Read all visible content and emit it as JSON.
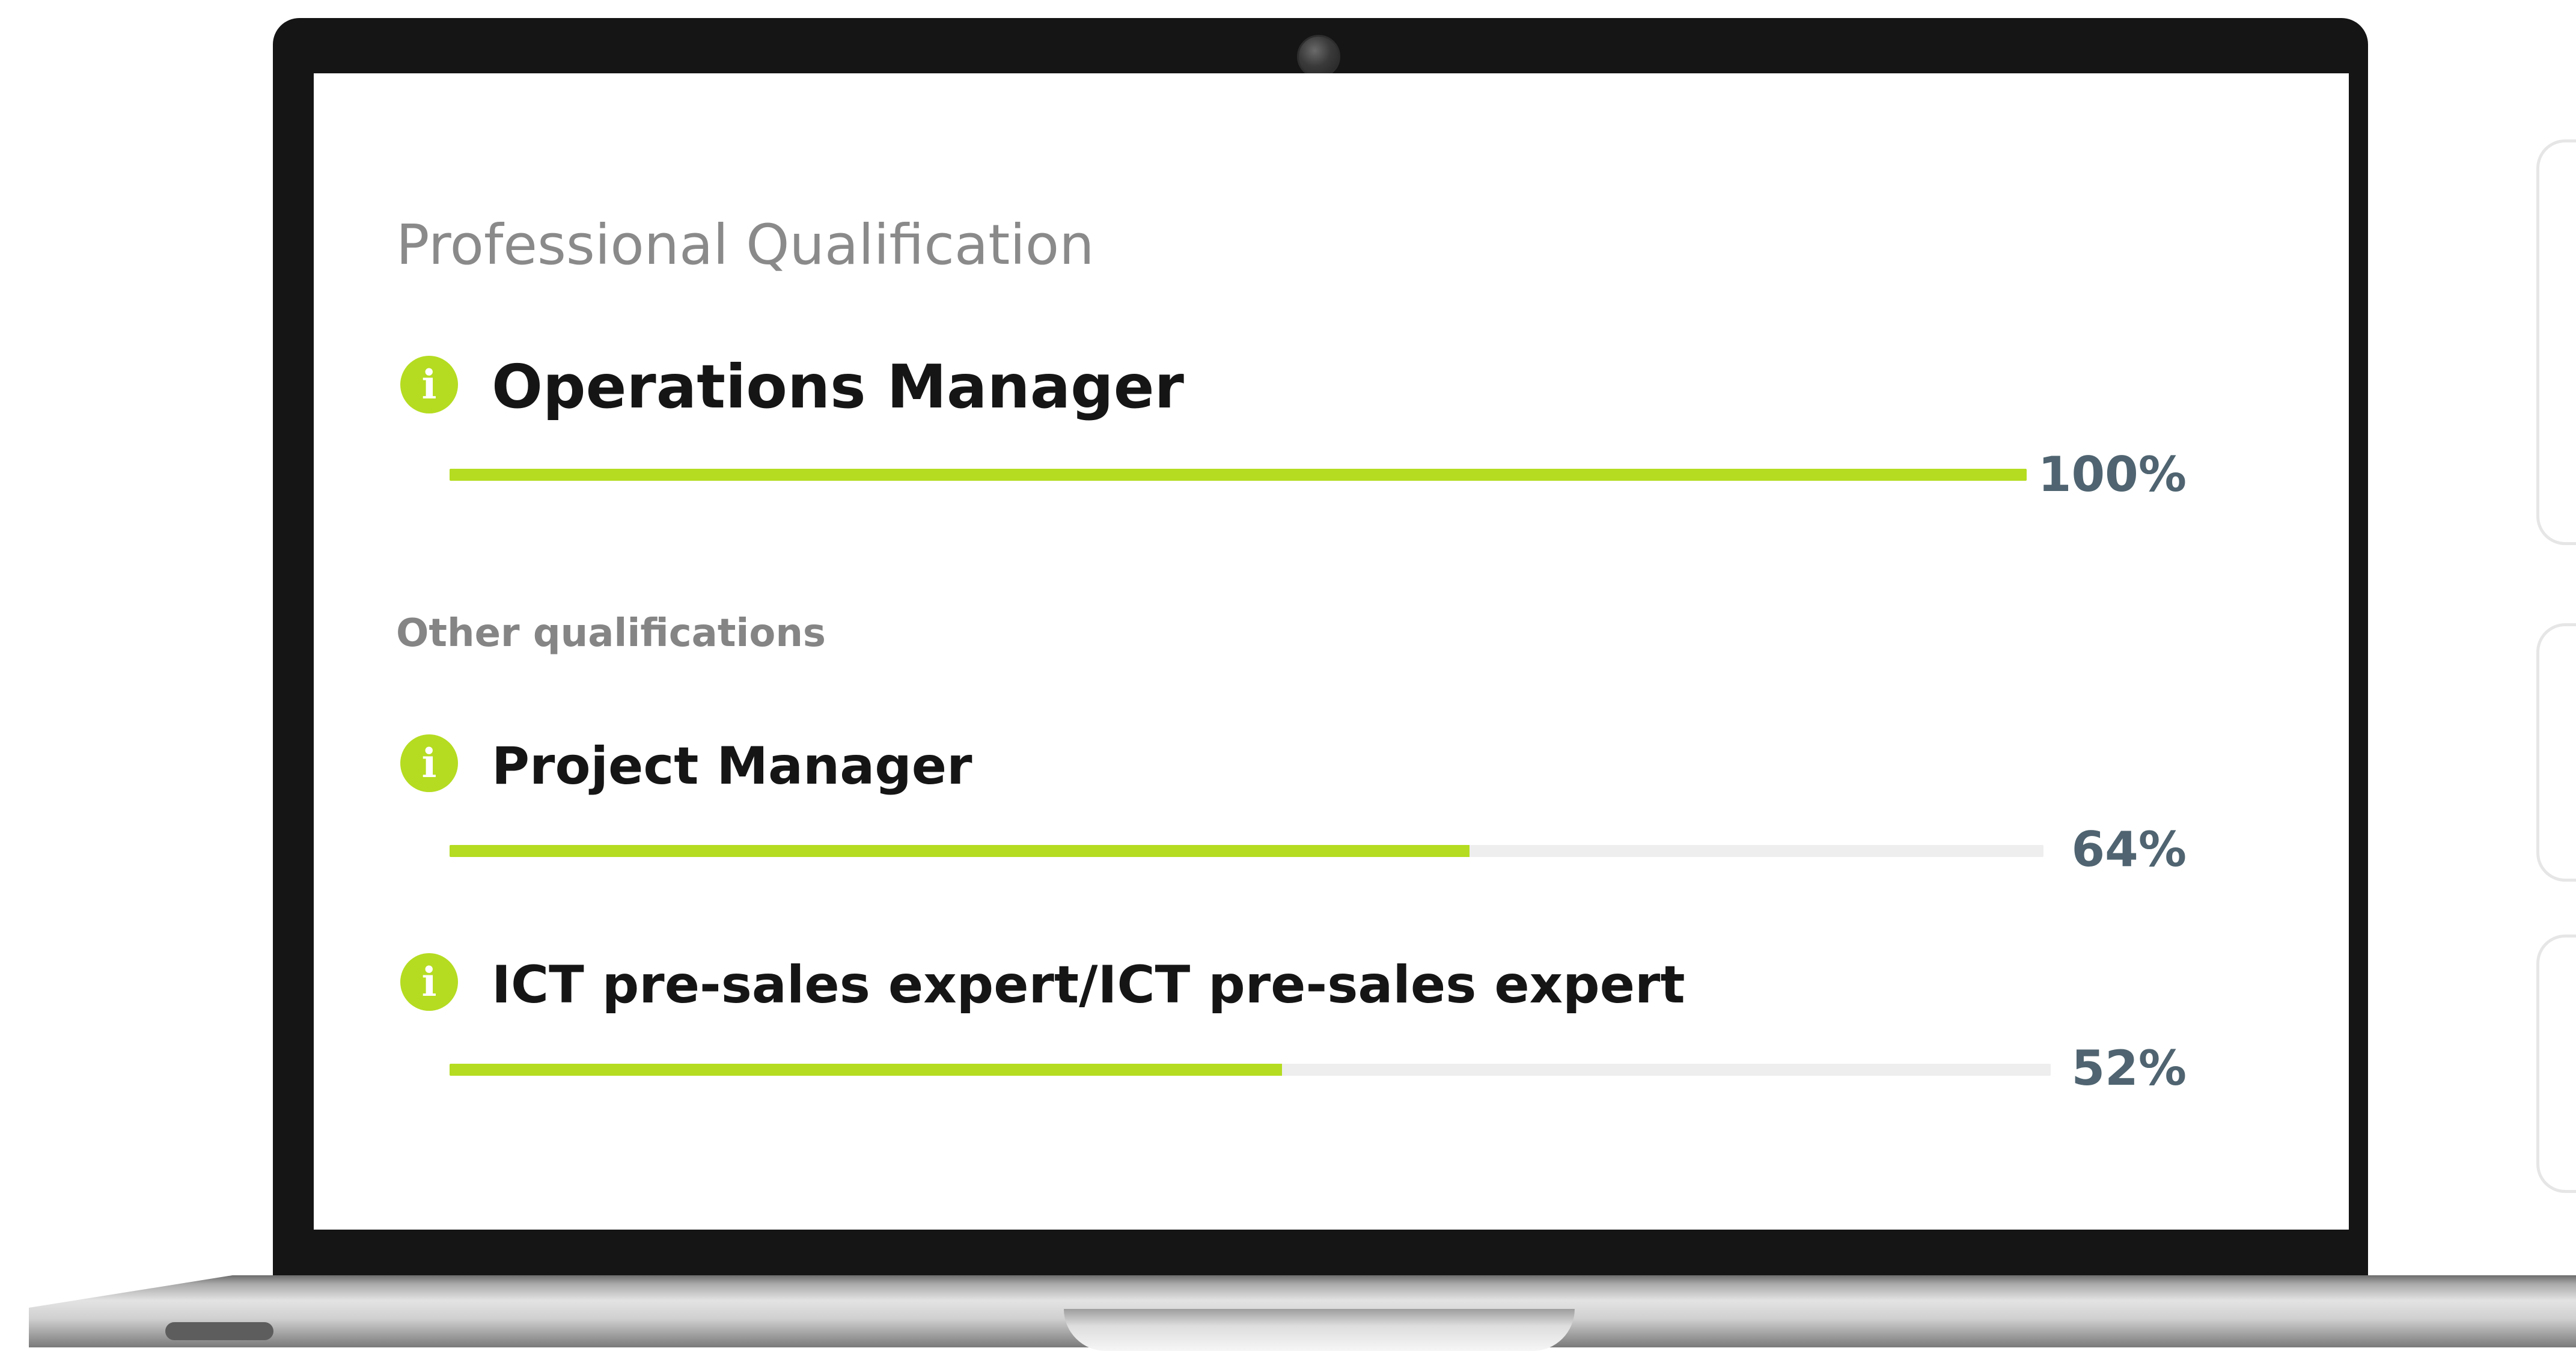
{
  "screen": {
    "section_title": "Professional Qualification",
    "subheading": "Other qualifications"
  },
  "qualifications": [
    {
      "name": "Operations Manager",
      "percent_label": "100%",
      "value": 100
    },
    {
      "name": "Project Manager",
      "percent_label": "64%",
      "value": 64
    },
    {
      "name": "ICT pre-sales expert/ICT pre-sales expert",
      "percent_label": "52%",
      "value": 52
    }
  ],
  "icons": {
    "info": "info-icon",
    "info_glyph": "i"
  },
  "colors": {
    "accent": "#b5dc21",
    "track": "#eeeeee",
    "percent_text": "#4f6470",
    "title_text": "#8a8a8a",
    "name_text": "#151515"
  }
}
